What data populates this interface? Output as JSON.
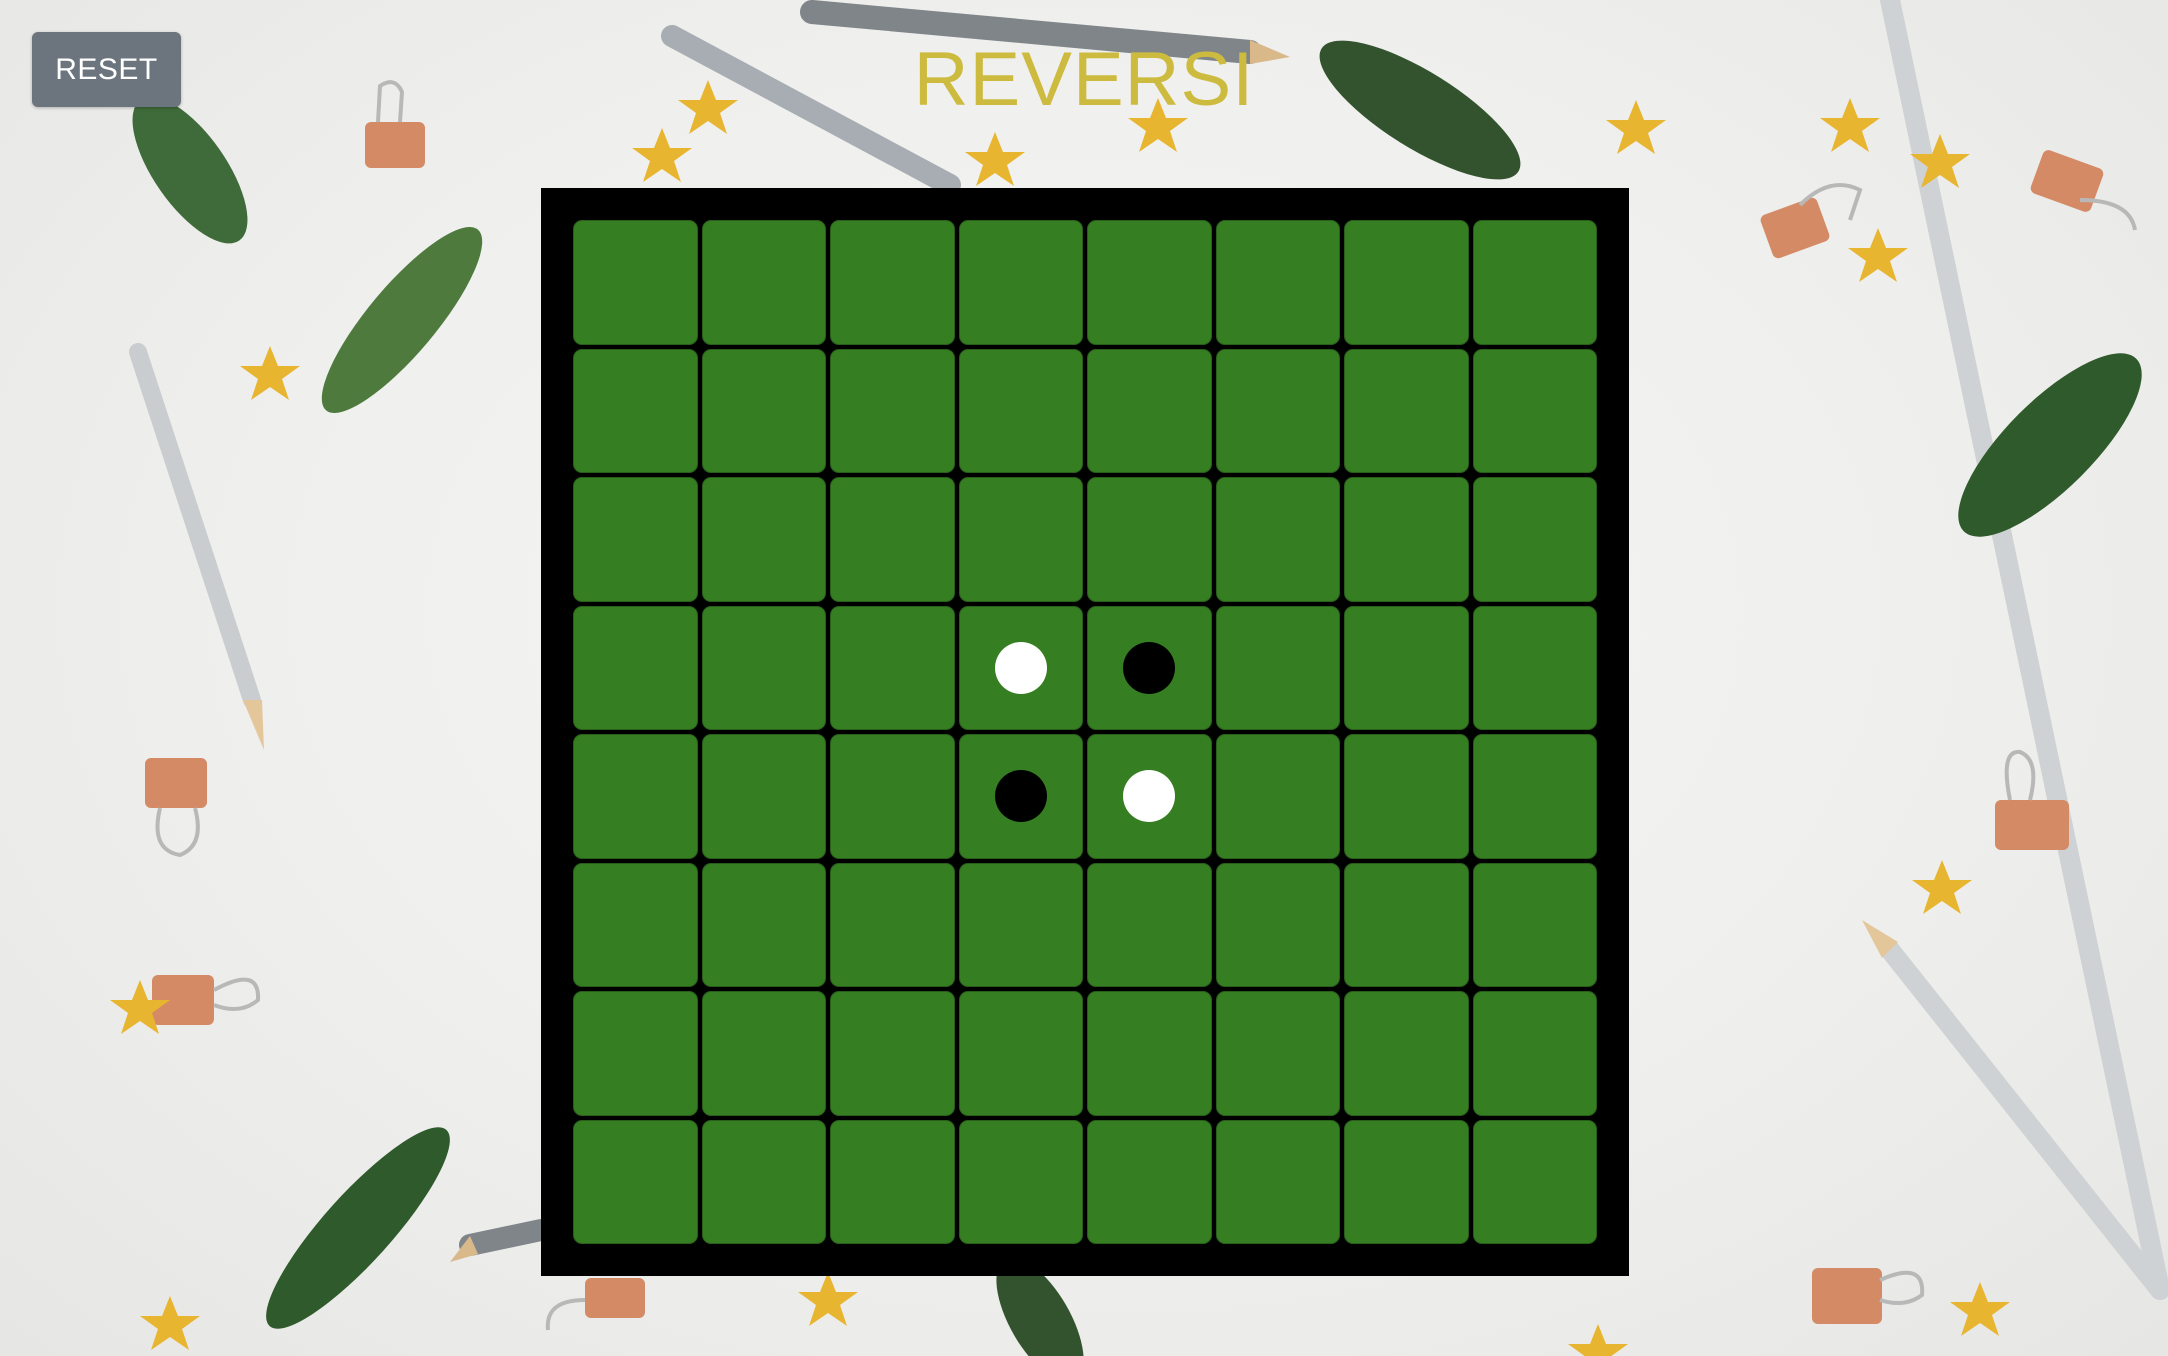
{
  "toolbar": {
    "reset_label": "RESET"
  },
  "header": {
    "title": "REVERSI"
  },
  "board": {
    "rows": 8,
    "cols": 8,
    "pieces": [
      {
        "row": 3,
        "col": 3,
        "color": "white"
      },
      {
        "row": 3,
        "col": 4,
        "color": "black"
      },
      {
        "row": 4,
        "col": 3,
        "color": "black"
      },
      {
        "row": 4,
        "col": 4,
        "color": "white"
      }
    ]
  },
  "colors": {
    "cell": "#367e22",
    "board_frame": "#000000",
    "title": "#cdbb3f",
    "button": "#6c757d"
  }
}
